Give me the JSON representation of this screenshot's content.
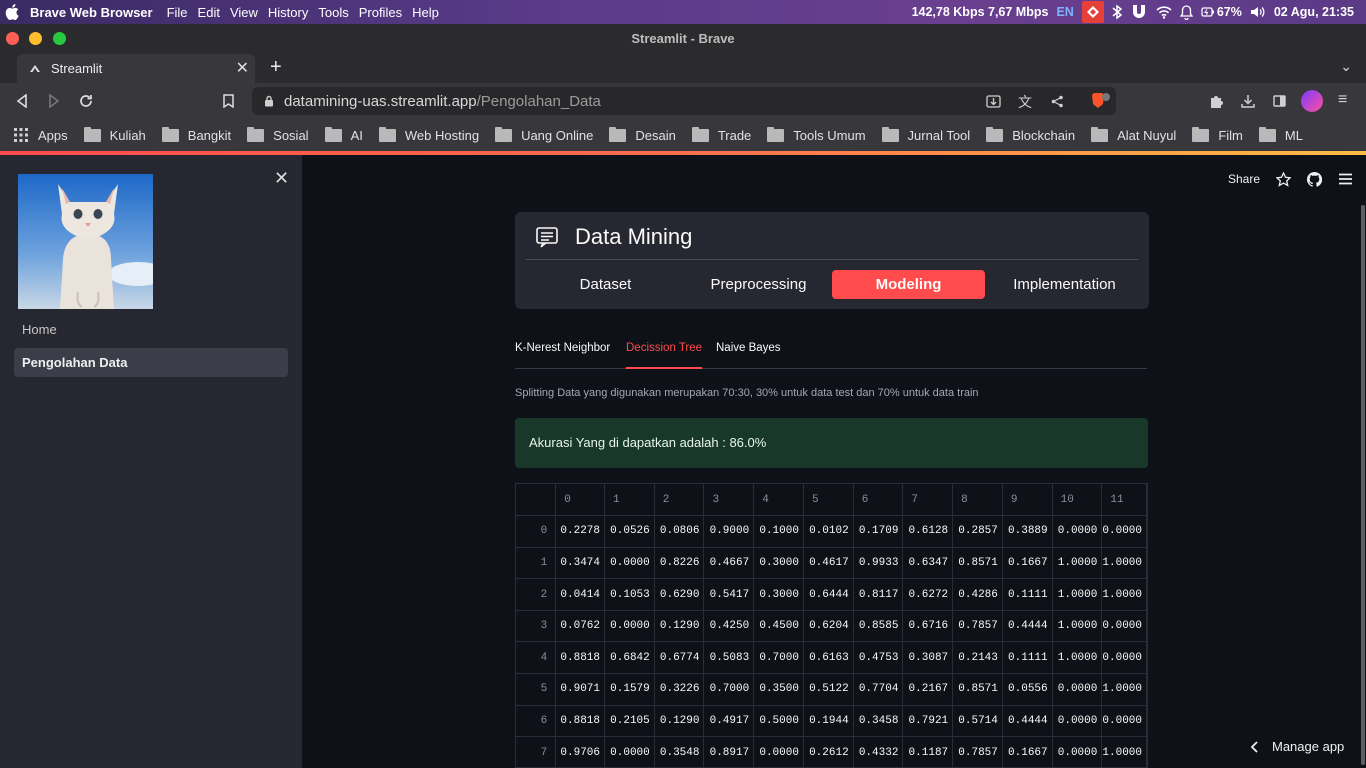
{
  "menubar": {
    "app_name": "Brave Web Browser",
    "items": [
      "File",
      "Edit",
      "View",
      "History",
      "Tools",
      "Profiles",
      "Help"
    ],
    "network": "142,78 Kbps 7,67 Mbps",
    "lang": "EN",
    "battery": "67%",
    "datetime": "02 Agu, 21:35"
  },
  "window": {
    "title": "Streamlit - Brave"
  },
  "tab": {
    "label": "Streamlit"
  },
  "address": {
    "host": "datamining-uas.streamlit.app",
    "path": "/Pengolahan_Data"
  },
  "bookmarks": [
    "Apps",
    "Kuliah",
    "Bangkit",
    "Sosial",
    "AI",
    "Web Hosting",
    "Uang Online",
    "Desain",
    "Trade",
    "Tools Umum",
    "Jurnal Tool",
    "Blockchain",
    "Alat Nuyul",
    "Film",
    "ML"
  ],
  "sidebar": {
    "nav": [
      "Home",
      "Pengolahan Data"
    ],
    "active": "Pengolahan Data"
  },
  "toolbar": {
    "share_label": "Share"
  },
  "menu_card": {
    "title": "Data Mining",
    "tabs": [
      "Dataset",
      "Preprocessing",
      "Modeling",
      "Implementation"
    ],
    "active_tab": "Modeling"
  },
  "subtabs": {
    "items": [
      "K-Nerest Neighbor",
      "Decission Tree",
      "Naive Bayes"
    ],
    "active": "Decission Tree"
  },
  "split_note": "Splitting Data yang digunakan merupakan 70:30, 30% untuk data test dan 70% untuk data train",
  "alert": {
    "text": "Akurasi Yang di dapatkan adalah : 86.0%"
  },
  "table": {
    "columns": [
      "0",
      "1",
      "2",
      "3",
      "4",
      "5",
      "6",
      "7",
      "8",
      "9",
      "10",
      "11"
    ],
    "rows": [
      {
        "index": "0",
        "cells": [
          "0.2278",
          "0.0526",
          "0.0806",
          "0.9000",
          "0.1000",
          "0.0102",
          "0.1709",
          "0.6128",
          "0.2857",
          "0.3889",
          "0.0000",
          "0.0000"
        ]
      },
      {
        "index": "1",
        "cells": [
          "0.3474",
          "0.0000",
          "0.8226",
          "0.4667",
          "0.3000",
          "0.4617",
          "0.9933",
          "0.6347",
          "0.8571",
          "0.1667",
          "1.0000",
          "1.0000"
        ]
      },
      {
        "index": "2",
        "cells": [
          "0.0414",
          "0.1053",
          "0.6290",
          "0.5417",
          "0.3000",
          "0.6444",
          "0.8117",
          "0.6272",
          "0.4286",
          "0.1111",
          "1.0000",
          "1.0000"
        ]
      },
      {
        "index": "3",
        "cells": [
          "0.0762",
          "0.0000",
          "0.1290",
          "0.4250",
          "0.4500",
          "0.6204",
          "0.8585",
          "0.6716",
          "0.7857",
          "0.4444",
          "1.0000",
          "0.0000"
        ]
      },
      {
        "index": "4",
        "cells": [
          "0.8818",
          "0.6842",
          "0.6774",
          "0.5083",
          "0.7000",
          "0.6163",
          "0.4753",
          "0.3087",
          "0.2143",
          "0.1111",
          "1.0000",
          "0.0000"
        ]
      },
      {
        "index": "5",
        "cells": [
          "0.9071",
          "0.1579",
          "0.3226",
          "0.7000",
          "0.3500",
          "0.5122",
          "0.7704",
          "0.2167",
          "0.8571",
          "0.0556",
          "0.0000",
          "1.0000"
        ]
      },
      {
        "index": "6",
        "cells": [
          "0.8818",
          "0.2105",
          "0.1290",
          "0.4917",
          "0.5000",
          "0.1944",
          "0.3458",
          "0.7921",
          "0.5714",
          "0.4444",
          "0.0000",
          "0.0000"
        ]
      },
      {
        "index": "7",
        "cells": [
          "0.9706",
          "0.0000",
          "0.3548",
          "0.8917",
          "0.0000",
          "0.2612",
          "0.4332",
          "0.1187",
          "0.7857",
          "0.1667",
          "0.0000",
          "1.0000"
        ]
      }
    ]
  },
  "manage_app": {
    "label": "Manage app"
  },
  "colors": {
    "accent": "#ff4b4b",
    "sidebar_bg": "#262730",
    "main_bg": "#0e1117",
    "success_bg": "#183829"
  }
}
